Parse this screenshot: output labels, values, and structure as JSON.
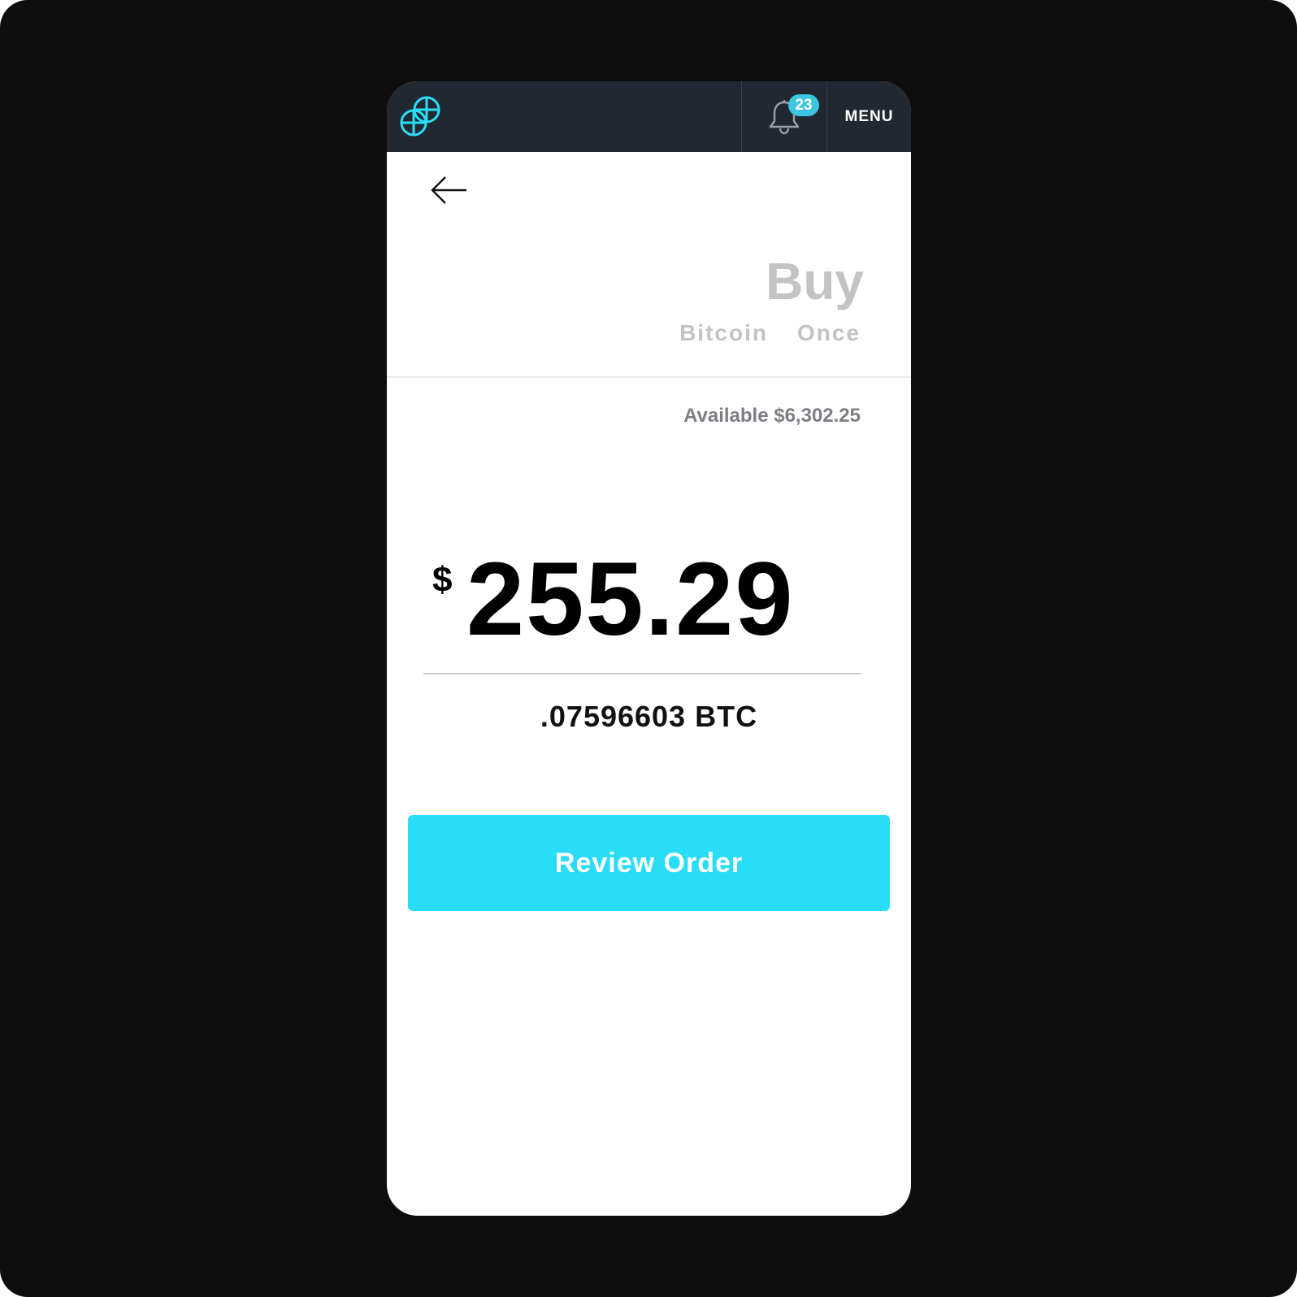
{
  "header": {
    "notifications_count": "23",
    "menu_label": "MENU"
  },
  "order": {
    "title": "Buy",
    "asset": "Bitcoin",
    "frequency": "Once",
    "available": "Available $6,302.25",
    "currency_symbol": "$",
    "amount": "255.29",
    "crypto_amount": ".07596603 BTC"
  },
  "actions": {
    "review_label": "Review Order"
  },
  "colors": {
    "accent": "#29dcf7",
    "badge": "#3cc5e0",
    "navbar": "#212831",
    "muted": "#c3c3c3"
  }
}
